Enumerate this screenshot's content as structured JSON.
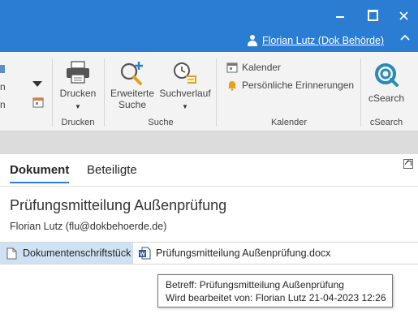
{
  "window": {
    "user_label": "Florian Lutz (Dok Behörde)"
  },
  "ribbon": {
    "drucken_group": {
      "drucken_button": "Drucken",
      "group_label": "Drucken"
    },
    "suche_group": {
      "erweiterte_line1": "Erweiterte",
      "erweiterte_line2": "Suche",
      "suchverlauf_button": "Suchverlauf",
      "group_label": "Suche"
    },
    "kalender_group": {
      "kalender_button": "Kalender",
      "erinnerungen_button": "Persönliche Erinnerungen",
      "group_label": "Kalender"
    },
    "csearch_group": {
      "csearch_button": "cSearch",
      "group_label": "cSearch"
    },
    "clipped_left": {
      "line1": "n",
      "line2": "n"
    }
  },
  "tabs": [
    {
      "label": "Dokument",
      "active": true
    },
    {
      "label": "Beteiligte",
      "active": false
    }
  ],
  "document": {
    "title": "Prüfungsmitteilung Außenprüfung",
    "author": "Florian Lutz (flu@dokbehoerde.de)"
  },
  "attachments": {
    "type_label": "Dokumentenschriftstück",
    "file_name": "Prüfungsmitteilung Außenprüfung.docx"
  },
  "tooltip": {
    "line1": "Betreff: Prüfungsmitteilung Außenprüfung",
    "line2": "Wird bearbeitet von: Florian Lutz 21-04-2023 12:26"
  },
  "colors": {
    "titlebar": "#2b7cd3",
    "accent": "#2b7cd3",
    "selected_row": "#cfe2f3",
    "ribbon_bg": "#f3f3f3"
  }
}
